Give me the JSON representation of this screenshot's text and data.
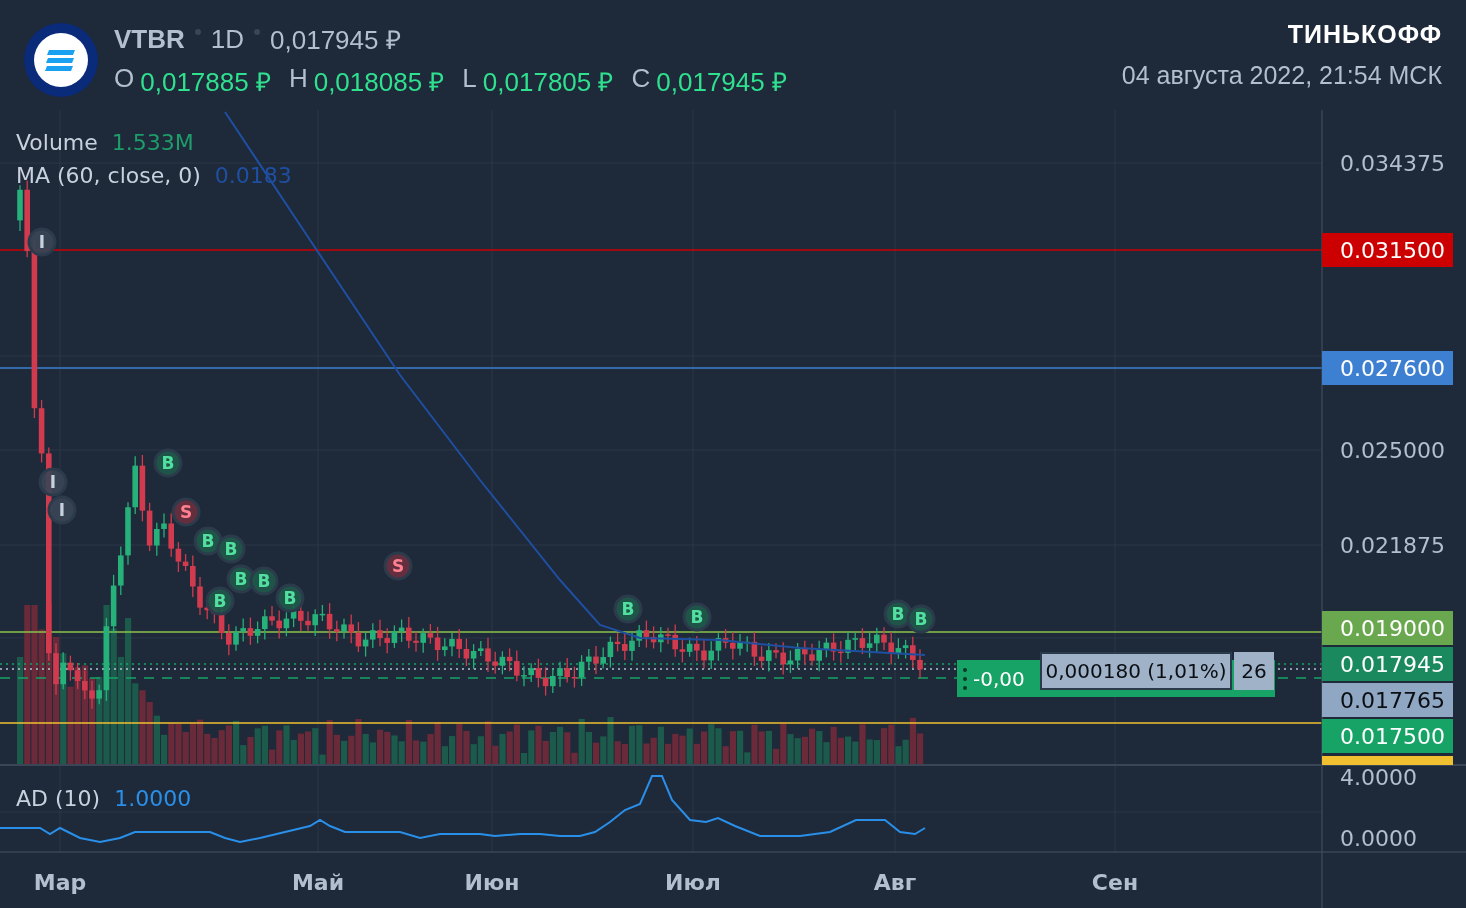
{
  "header": {
    "ticker": "VTBR",
    "interval": "1D",
    "price": "0,017945 ₽",
    "ohlc": [
      {
        "label": "O",
        "value": "0,017885 ₽"
      },
      {
        "label": "H",
        "value": "0,018085 ₽"
      },
      {
        "label": "L",
        "value": "0,017805 ₽"
      },
      {
        "label": "C",
        "value": "0,017945 ₽"
      }
    ],
    "brand": "ТИНЬКОФФ",
    "datetime": "04 августа 2022, 21:54 МСК"
  },
  "legend": [
    {
      "kind": "volume",
      "label": "Volume",
      "value": "1.533M"
    },
    {
      "kind": "ma",
      "label": "MA (60, close, 0)",
      "value": "0.0183"
    }
  ],
  "price_axis": [
    {
      "kind": "tick",
      "text": "0.034375"
    },
    {
      "kind": "tag",
      "text": "0.031500",
      "color": "#cc0000"
    },
    {
      "kind": "tag",
      "text": "0.027600",
      "color": "#3d7fd0"
    },
    {
      "kind": "tick",
      "text": "0.025000"
    },
    {
      "kind": "tick",
      "text": "0.021875"
    },
    {
      "kind": "tag",
      "text": "0.019000",
      "color": "#6aa84f"
    },
    {
      "kind": "tag",
      "text": "0.017945",
      "color": "#1a8a5e"
    },
    {
      "kind": "tag",
      "text": "0.017765",
      "color": "#8fa7c2"
    },
    {
      "kind": "tag",
      "text": "0.017500",
      "color": "#17a266"
    }
  ],
  "markers": [
    {
      "kind": "info",
      "text": "I"
    },
    {
      "kind": "info",
      "text": "I"
    },
    {
      "kind": "info",
      "text": "I"
    },
    {
      "kind": "buy",
      "text": "B"
    },
    {
      "kind": "sell",
      "text": "S"
    },
    {
      "kind": "buy",
      "text": "B"
    },
    {
      "kind": "buy",
      "text": "B"
    },
    {
      "kind": "buy",
      "text": "B"
    },
    {
      "kind": "buy",
      "text": "B"
    },
    {
      "kind": "buy",
      "text": "B"
    },
    {
      "kind": "buy",
      "text": "B"
    },
    {
      "kind": "sell",
      "text": "S"
    },
    {
      "kind": "buy",
      "text": "B"
    },
    {
      "kind": "buy",
      "text": "B"
    },
    {
      "kind": "buy",
      "text": "B"
    },
    {
      "kind": "buy",
      "text": "B"
    }
  ],
  "position": {
    "pnl": "-0,00",
    "change": "0,000180 (1,01%)",
    "quantity": "26"
  },
  "ad": {
    "label": "AD (10)",
    "value": "1.0000",
    "axis": [
      "4.0000",
      "0.0000"
    ]
  },
  "time_axis": [
    "Мар",
    "Май",
    "Июн",
    "Июл",
    "Авг",
    "Сен"
  ]
}
